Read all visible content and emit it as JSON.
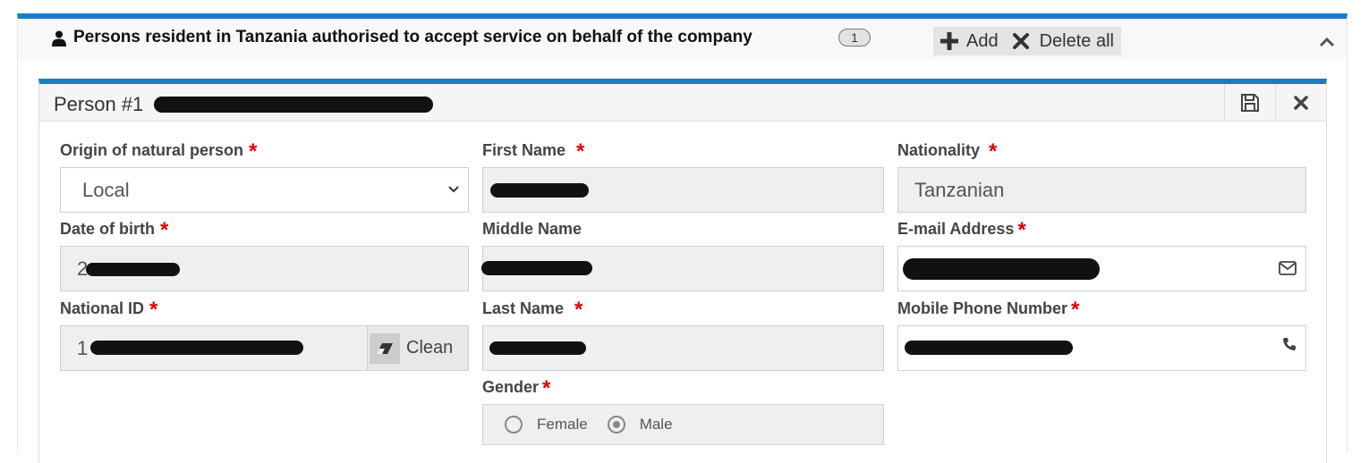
{
  "section": {
    "title": "Persons resident in Tanzania authorised to accept service on behalf of the company",
    "count": "1",
    "add_label": "Add",
    "delete_all_label": "Delete all",
    "accent_color": "#1b7bc4"
  },
  "person": {
    "title": "Person #1",
    "origin": {
      "label": "Origin of natural person",
      "value": "Local"
    },
    "first_name": {
      "label": "First Name",
      "value": ""
    },
    "nationality": {
      "label": "Nationality",
      "value": "Tanzanian"
    },
    "dob": {
      "label": "Date of birth",
      "value": "2"
    },
    "middle_name": {
      "label": "Middle Name",
      "value": ""
    },
    "email": {
      "label": "E-mail Address",
      "value": ""
    },
    "national_id": {
      "label": "National ID",
      "value": "1",
      "clean_label": "Clean"
    },
    "last_name": {
      "label": "Last Name",
      "value": ""
    },
    "mobile": {
      "label": "Mobile Phone Number",
      "value": ""
    },
    "gender": {
      "label": "Gender",
      "options": [
        "Female",
        "Male"
      ],
      "selected": "Male"
    }
  },
  "icons": {
    "section": "user-icon",
    "add": "plus-icon",
    "delete_all": "times-icon",
    "collapse": "chevron-up-icon",
    "save": "floppy-disk-icon",
    "close": "close-icon",
    "select": "chevron-down-icon",
    "email": "envelope-icon",
    "phone": "phone-icon",
    "clean": "eraser-icon"
  },
  "required_color": "#e00000"
}
